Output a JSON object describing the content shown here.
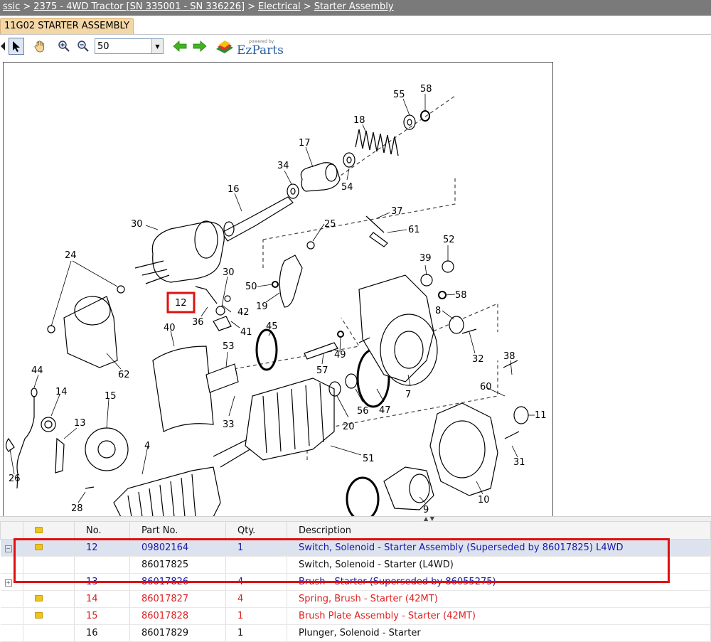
{
  "breadcrumb": {
    "items": [
      {
        "label": "ssic"
      },
      {
        "label": "2375 - 4WD Tractor [SN 335001 - SN 336226]"
      },
      {
        "label": "Electrical"
      },
      {
        "label": "Starter Assembly"
      }
    ],
    "separator": ">"
  },
  "tab": {
    "label": "11G02 STARTER ASSEMBLY"
  },
  "toolbar": {
    "zoom_value": "50",
    "logo_powered": "powered by",
    "logo_name": "EzParts"
  },
  "diagram": {
    "callouts": [
      "55",
      "58",
      "18",
      "17",
      "34",
      "54",
      "16",
      "30",
      "25",
      "37",
      "61",
      "52",
      "24",
      "39",
      "30",
      "50",
      "58",
      "12",
      "42",
      "19",
      "36",
      "41",
      "8",
      "45",
      "40",
      "53",
      "49",
      "32",
      "62",
      "44",
      "14",
      "15",
      "57",
      "38",
      "60",
      "11",
      "7",
      "56",
      "47",
      "20",
      "33",
      "13",
      "51",
      "31",
      "26",
      "4",
      "28",
      "9",
      "10"
    ],
    "selected_callout": "12"
  },
  "table": {
    "columns": {
      "icon": "",
      "no": "No.",
      "part_no": "Part No.",
      "qty": "Qty.",
      "description": "Description"
    },
    "rows": [
      {
        "no": "12",
        "part_no": "09802164",
        "qty": "1",
        "description": "Switch, Solenoid - Starter Assembly (Superseded by 86017825) L4WD",
        "style": "selected",
        "expander": "−",
        "folder": true
      },
      {
        "no": "",
        "part_no": "86017825",
        "qty": "",
        "description": "Switch, Solenoid - Starter (L4WD)",
        "style": "sub",
        "expander": "",
        "folder": false
      },
      {
        "no": "13",
        "part_no": "86017826",
        "qty": "4",
        "description": "Brush - Starter (Superseded by 86055275)",
        "style": "blue",
        "expander": "+",
        "folder": false
      },
      {
        "no": "14",
        "part_no": "86017827",
        "qty": "4",
        "description": "Spring, Brush - Starter (42MT)",
        "style": "red",
        "expander": "",
        "folder": true
      },
      {
        "no": "15",
        "part_no": "86017828",
        "qty": "1",
        "description": "Brush Plate Assembly - Starter (42MT)",
        "style": "red",
        "expander": "",
        "folder": true
      },
      {
        "no": "16",
        "part_no": "86017829",
        "qty": "1",
        "description": "Plunger, Solenoid - Starter",
        "style": "black",
        "expander": "",
        "folder": false
      }
    ]
  }
}
